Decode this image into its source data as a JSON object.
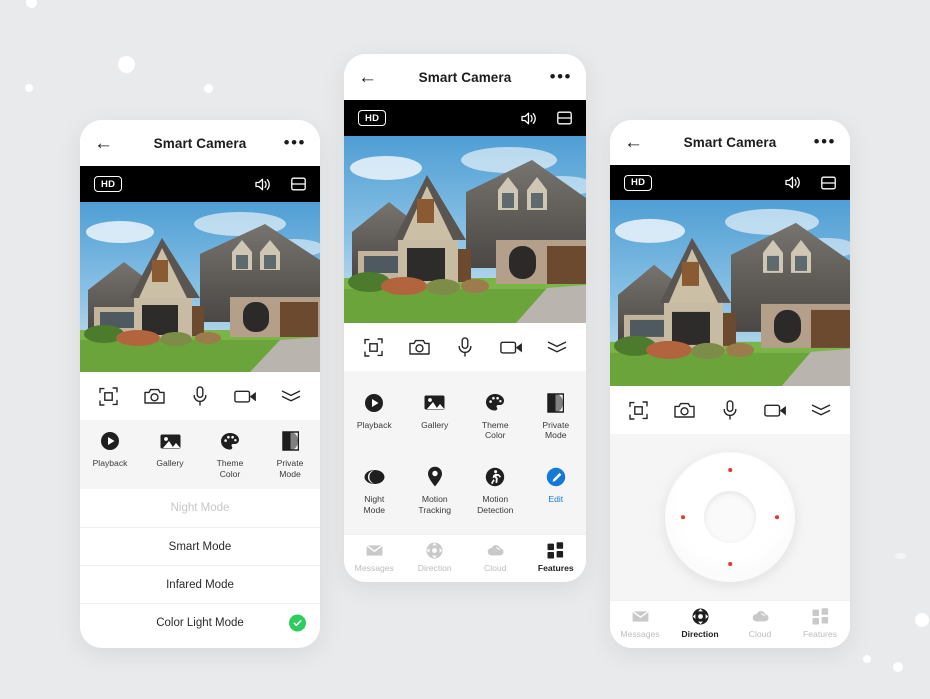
{
  "page": {
    "background_color": "#e9eaeb",
    "accent_blue": "#1379d6",
    "accent_green": "#2ecc5c",
    "marker_red": "#e03b2f"
  },
  "header": {
    "title": "Smart Camera",
    "back_icon": "back-arrow-icon",
    "more_icon": "more-options-icon",
    "more_glyph": "•••",
    "back_glyph": "←"
  },
  "video_bar": {
    "quality_badge": "HD",
    "speaker_icon": "speaker-icon",
    "screenshot_icon": "split-screen-icon"
  },
  "toolbar": {
    "items": [
      {
        "icon": "fullscreen-icon",
        "name": "fullscreen-button"
      },
      {
        "icon": "camera-icon",
        "name": "snapshot-button"
      },
      {
        "icon": "microphone-icon",
        "name": "talk-button"
      },
      {
        "icon": "video-camera-icon",
        "name": "record-button"
      },
      {
        "icon": "collapse-wave-icon",
        "name": "collapse-button"
      }
    ]
  },
  "features": {
    "row1": [
      {
        "label": "Playback",
        "icon": "playback-icon"
      },
      {
        "label": "Gallery",
        "icon": "gallery-icon"
      },
      {
        "label": "Theme\nColor",
        "label_line1": "Theme",
        "label_line2": "Color",
        "icon": "palette-icon"
      },
      {
        "label": "Private\nMode",
        "label_line1": "Private",
        "label_line2": "Mode",
        "icon": "private-mode-icon"
      }
    ],
    "row2": [
      {
        "label_line1": "Night",
        "label_line2": "Mode",
        "icon": "night-mode-icon"
      },
      {
        "label_line1": "Motion",
        "label_line2": "Tracking",
        "icon": "location-pin-icon"
      },
      {
        "label_line1": "Motion",
        "label_line2": "Detection",
        "icon": "motion-detection-icon"
      },
      {
        "label_line1": "Edit",
        "label_line2": "",
        "icon": "edit-pencil-icon"
      }
    ]
  },
  "mode_list": {
    "items": [
      {
        "label": "Night Mode",
        "state": "disabled",
        "selected": false
      },
      {
        "label": "Smart Mode",
        "state": "normal",
        "selected": false
      },
      {
        "label": "Infared Mode",
        "state": "normal",
        "selected": false
      },
      {
        "label": "Color Light Mode",
        "state": "normal",
        "selected": true
      }
    ],
    "check_icon": "check-circle-icon"
  },
  "direction_pad": {
    "name": "direction-pad",
    "markers": [
      "up",
      "right",
      "down",
      "left"
    ]
  },
  "bottom_nav": {
    "items": [
      {
        "label": "Messages",
        "icon": "mail-icon",
        "active": false
      },
      {
        "label": "Direction",
        "icon": "direction-icon",
        "active": false
      },
      {
        "label": "Cloud",
        "icon": "cloud-icon",
        "active": false
      },
      {
        "label": "Features",
        "icon": "grid-icon",
        "active": true
      }
    ],
    "active_center": "Direction",
    "active_right": "Features"
  }
}
